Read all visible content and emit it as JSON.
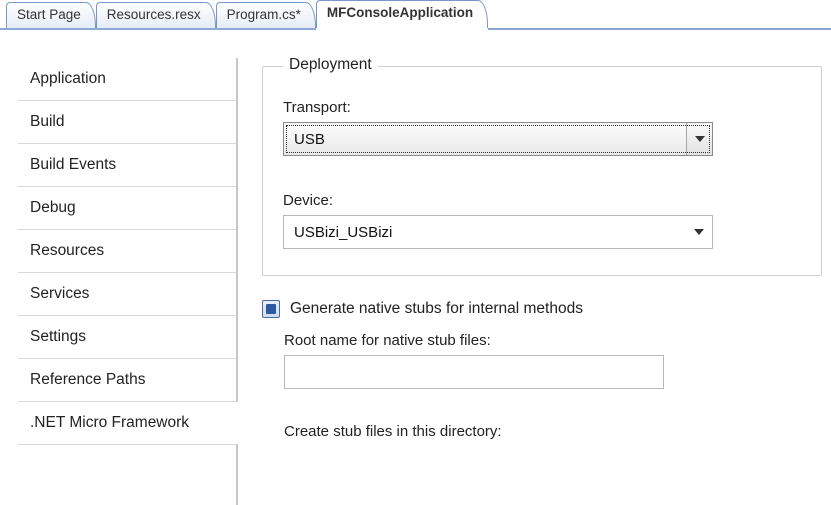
{
  "tabs": [
    {
      "label": "Start Page",
      "active": false
    },
    {
      "label": "Resources.resx",
      "active": false
    },
    {
      "label": "Program.cs*",
      "active": false
    },
    {
      "label": "MFConsoleApplication",
      "active": true
    }
  ],
  "sidenav": {
    "items": [
      "Application",
      "Build",
      "Build Events",
      "Debug",
      "Resources",
      "Services",
      "Settings",
      "Reference Paths",
      ".NET Micro Framework"
    ],
    "selected_index": 8
  },
  "deployment": {
    "group_title": "Deployment",
    "transport_label": "Transport:",
    "transport_value": "USB",
    "device_label": "Device:",
    "device_value": "USBizi_USBizi"
  },
  "stubs": {
    "checkbox_label": "Generate native stubs for internal methods",
    "checked": true,
    "root_name_label": "Root name for native stub files:",
    "root_name_value": "",
    "dir_label": "Create stub files in this directory:"
  }
}
